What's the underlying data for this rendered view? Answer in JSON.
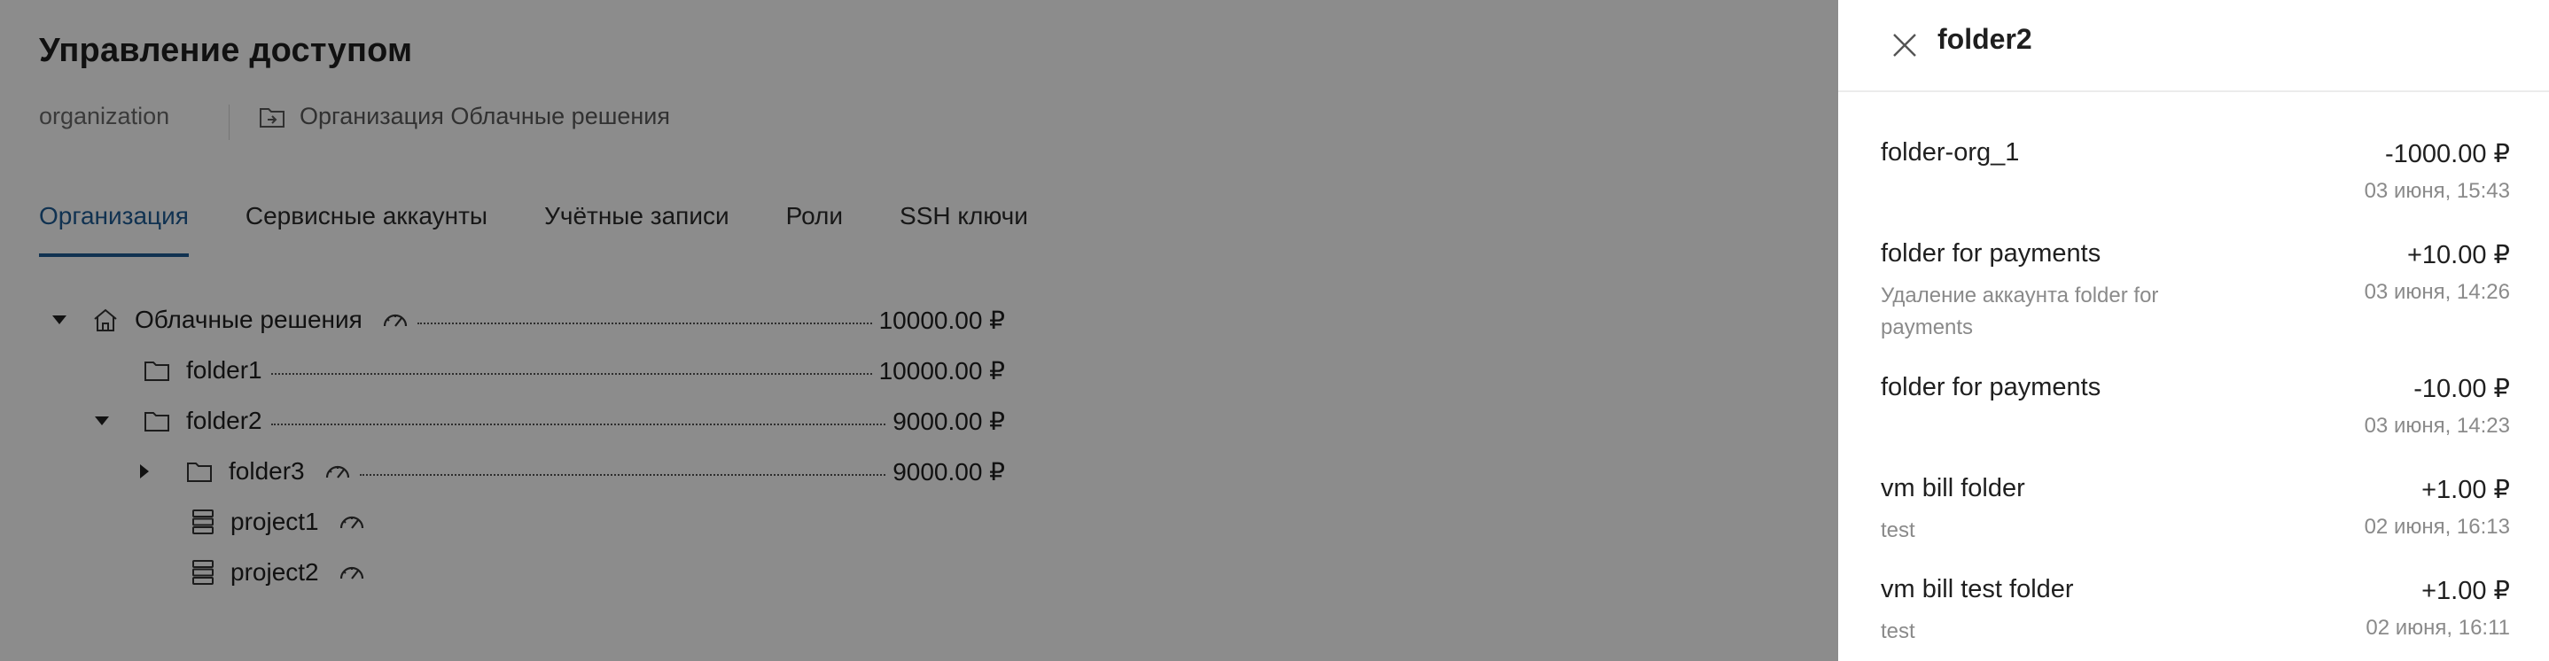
{
  "page": {
    "title": "Управление доступом",
    "breadcrumb": {
      "org": "organization",
      "folder": "Организация Облачные решения"
    },
    "tabs": [
      {
        "label": "Организация",
        "active": true
      },
      {
        "label": "Сервисные аккаунты"
      },
      {
        "label": "Учётные записи"
      },
      {
        "label": "Роли"
      },
      {
        "label": "SSH ключи"
      }
    ],
    "tree": [
      {
        "label": "Облачные решения",
        "amount": "10000.00 ₽",
        "icon": "home-icon",
        "caret": "down",
        "gauge": true
      },
      {
        "label": "folder1",
        "amount": "10000.00 ₽",
        "icon": "folder-icon"
      },
      {
        "label": "folder2",
        "amount": "9000.00 ₽",
        "icon": "folder-icon",
        "caret": "down"
      },
      {
        "label": "folder3",
        "amount": "9000.00 ₽",
        "icon": "folder-icon",
        "caret": "right",
        "gauge": true
      },
      {
        "label": "project1",
        "icon": "project-stack-icon",
        "gauge": true
      },
      {
        "label": "project2",
        "icon": "project-stack-icon",
        "gauge": true
      }
    ]
  },
  "drawer": {
    "title": "folder2",
    "transactions": [
      {
        "name": "folder-org_1",
        "description": "",
        "amount": "-1000.00 ₽",
        "date": "03 июня, 15:43"
      },
      {
        "name": "folder for payments",
        "description": "Удаление аккаунта folder for payments",
        "amount": "+10.00 ₽",
        "date": "03 июня, 14:26"
      },
      {
        "name": "folder for payments",
        "description": "",
        "amount": "-10.00 ₽",
        "date": "03 июня, 14:23"
      },
      {
        "name": "vm bill folder",
        "description": "test",
        "amount": "+1.00 ₽",
        "date": "02 июня, 16:13"
      },
      {
        "name": "vm bill test folder",
        "description": "test",
        "amount": "+1.00 ₽",
        "date": "02 июня, 16:11"
      }
    ]
  },
  "colors": {
    "accent": "#1e5b94",
    "overlay": "rgba(0,0,0,0.45)"
  }
}
